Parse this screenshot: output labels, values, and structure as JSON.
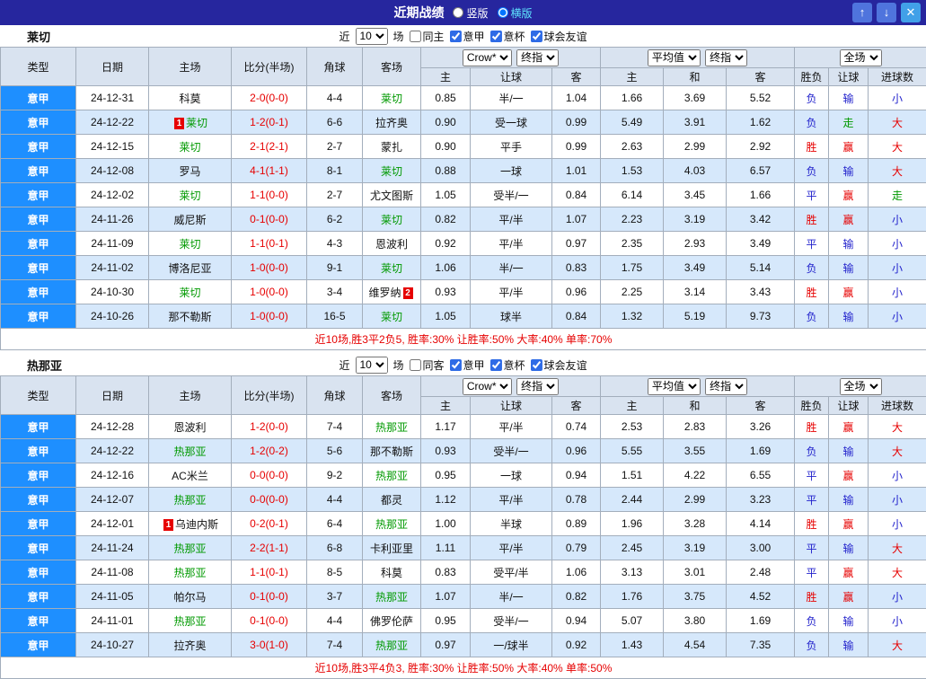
{
  "header": {
    "title": "近期战绩",
    "view_options": [
      {
        "label": "竖版",
        "selected": false
      },
      {
        "label": "横版",
        "selected": true
      }
    ],
    "up_button": "↑",
    "down_button": "↓",
    "close_button": "✕"
  },
  "table_head": {
    "info_columns": [
      "类型",
      "日期",
      "主场",
      "比分(半场)",
      "角球",
      "客场"
    ],
    "sub_columns": [
      "主",
      "让球",
      "客",
      "主",
      "和",
      "客",
      "胜负",
      "让球",
      "进球数"
    ],
    "asia_selects": [
      "Crow*",
      "终指"
    ],
    "euro_selects": [
      "平均值",
      "终指"
    ],
    "scope_select": "全场"
  },
  "colors": {
    "topbar": "#26269e",
    "league_cell": "#1e8fff",
    "subject_team_green": "#009900",
    "score_red": "#e60000",
    "win_red": "#e60000",
    "lose_blue": "#2222cc",
    "push_green": "#009900",
    "alt_row": "#d6e8fb",
    "header_row": "#d9e3f0",
    "active_view": "#5fe6ff"
  },
  "sections": [
    {
      "team": "莱切",
      "controls": {
        "prefix": "近",
        "count": "10",
        "suffix": "场",
        "checkboxes": [
          {
            "label": "同主",
            "checked": false
          },
          {
            "label": "意甲",
            "checked": true
          },
          {
            "label": "意杯",
            "checked": true
          },
          {
            "label": "球会友谊",
            "checked": true
          }
        ]
      },
      "rows": [
        {
          "league": "意甲",
          "date": "24-12-31",
          "home": "科莫",
          "home_cards": "",
          "home_subject": false,
          "score": "2-0(0-0)",
          "corner": "4-4",
          "away": "莱切",
          "away_cards": "",
          "away_subject": true,
          "asia": [
            "0.85",
            "半/一",
            "1.04"
          ],
          "euro": [
            "1.66",
            "3.69",
            "5.52"
          ],
          "results": [
            "负",
            "输",
            "小"
          ]
        },
        {
          "league": "意甲",
          "date": "24-12-22",
          "home": "莱切",
          "home_cards": "1",
          "home_subject": true,
          "score": "1-2(0-1)",
          "corner": "6-6",
          "away": "拉齐奥",
          "away_cards": "",
          "away_subject": false,
          "asia": [
            "0.90",
            "受一球",
            "0.99"
          ],
          "euro": [
            "5.49",
            "3.91",
            "1.62"
          ],
          "results": [
            "负",
            "走",
            "大"
          ]
        },
        {
          "league": "意甲",
          "date": "24-12-15",
          "home": "莱切",
          "home_cards": "",
          "home_subject": true,
          "score": "2-1(2-1)",
          "corner": "2-7",
          "away": "蒙扎",
          "away_cards": "",
          "away_subject": false,
          "asia": [
            "0.90",
            "平手",
            "0.99"
          ],
          "euro": [
            "2.63",
            "2.99",
            "2.92"
          ],
          "results": [
            "胜",
            "赢",
            "大"
          ]
        },
        {
          "league": "意甲",
          "date": "24-12-08",
          "home": "罗马",
          "home_cards": "",
          "home_subject": false,
          "score": "4-1(1-1)",
          "corner": "8-1",
          "away": "莱切",
          "away_cards": "",
          "away_subject": true,
          "asia": [
            "0.88",
            "一球",
            "1.01"
          ],
          "euro": [
            "1.53",
            "4.03",
            "6.57"
          ],
          "results": [
            "负",
            "输",
            "大"
          ]
        },
        {
          "league": "意甲",
          "date": "24-12-02",
          "home": "莱切",
          "home_cards": "",
          "home_subject": true,
          "score": "1-1(0-0)",
          "corner": "2-7",
          "away": "尤文图斯",
          "away_cards": "",
          "away_subject": false,
          "asia": [
            "1.05",
            "受半/一",
            "0.84"
          ],
          "euro": [
            "6.14",
            "3.45",
            "1.66"
          ],
          "results": [
            "平",
            "赢",
            "走"
          ]
        },
        {
          "league": "意甲",
          "date": "24-11-26",
          "home": "威尼斯",
          "home_cards": "",
          "home_subject": false,
          "score": "0-1(0-0)",
          "corner": "6-2",
          "away": "莱切",
          "away_cards": "",
          "away_subject": true,
          "asia": [
            "0.82",
            "平/半",
            "1.07"
          ],
          "euro": [
            "2.23",
            "3.19",
            "3.42"
          ],
          "results": [
            "胜",
            "赢",
            "小"
          ]
        },
        {
          "league": "意甲",
          "date": "24-11-09",
          "home": "莱切",
          "home_cards": "",
          "home_subject": true,
          "score": "1-1(0-1)",
          "corner": "4-3",
          "away": "恩波利",
          "away_cards": "",
          "away_subject": false,
          "asia": [
            "0.92",
            "平/半",
            "0.97"
          ],
          "euro": [
            "2.35",
            "2.93",
            "3.49"
          ],
          "results": [
            "平",
            "输",
            "小"
          ]
        },
        {
          "league": "意甲",
          "date": "24-11-02",
          "home": "博洛尼亚",
          "home_cards": "",
          "home_subject": false,
          "score": "1-0(0-0)",
          "corner": "9-1",
          "away": "莱切",
          "away_cards": "",
          "away_subject": true,
          "asia": [
            "1.06",
            "半/一",
            "0.83"
          ],
          "euro": [
            "1.75",
            "3.49",
            "5.14"
          ],
          "results": [
            "负",
            "输",
            "小"
          ]
        },
        {
          "league": "意甲",
          "date": "24-10-30",
          "home": "莱切",
          "home_cards": "",
          "home_subject": true,
          "score": "1-0(0-0)",
          "corner": "3-4",
          "away": "维罗纳",
          "away_cards": "2",
          "away_subject": false,
          "asia": [
            "0.93",
            "平/半",
            "0.96"
          ],
          "euro": [
            "2.25",
            "3.14",
            "3.43"
          ],
          "results": [
            "胜",
            "赢",
            "小"
          ]
        },
        {
          "league": "意甲",
          "date": "24-10-26",
          "home": "那不勒斯",
          "home_cards": "",
          "home_subject": false,
          "score": "1-0(0-0)",
          "corner": "16-5",
          "away": "莱切",
          "away_cards": "",
          "away_subject": true,
          "asia": [
            "1.05",
            "球半",
            "0.84"
          ],
          "euro": [
            "1.32",
            "5.19",
            "9.73"
          ],
          "results": [
            "负",
            "输",
            "小"
          ]
        }
      ],
      "summary": "近10场,胜3平2负5, 胜率:30% 让胜率:50% 大率:40% 单率:70%"
    },
    {
      "team": "热那亚",
      "controls": {
        "prefix": "近",
        "count": "10",
        "suffix": "场",
        "checkboxes": [
          {
            "label": "同客",
            "checked": false
          },
          {
            "label": "意甲",
            "checked": true
          },
          {
            "label": "意杯",
            "checked": true
          },
          {
            "label": "球会友谊",
            "checked": true
          }
        ]
      },
      "rows": [
        {
          "league": "意甲",
          "date": "24-12-28",
          "home": "恩波利",
          "home_cards": "",
          "home_subject": false,
          "score": "1-2(0-0)",
          "corner": "7-4",
          "away": "热那亚",
          "away_cards": "",
          "away_subject": true,
          "asia": [
            "1.17",
            "平/半",
            "0.74"
          ],
          "euro": [
            "2.53",
            "2.83",
            "3.26"
          ],
          "results": [
            "胜",
            "赢",
            "大"
          ]
        },
        {
          "league": "意甲",
          "date": "24-12-22",
          "home": "热那亚",
          "home_cards": "",
          "home_subject": true,
          "score": "1-2(0-2)",
          "corner": "5-6",
          "away": "那不勒斯",
          "away_cards": "",
          "away_subject": false,
          "asia": [
            "0.93",
            "受半/一",
            "0.96"
          ],
          "euro": [
            "5.55",
            "3.55",
            "1.69"
          ],
          "results": [
            "负",
            "输",
            "大"
          ]
        },
        {
          "league": "意甲",
          "date": "24-12-16",
          "home": "AC米兰",
          "home_cards": "",
          "home_subject": false,
          "score": "0-0(0-0)",
          "corner": "9-2",
          "away": "热那亚",
          "away_cards": "",
          "away_subject": true,
          "asia": [
            "0.95",
            "一球",
            "0.94"
          ],
          "euro": [
            "1.51",
            "4.22",
            "6.55"
          ],
          "results": [
            "平",
            "赢",
            "小"
          ]
        },
        {
          "league": "意甲",
          "date": "24-12-07",
          "home": "热那亚",
          "home_cards": "",
          "home_subject": true,
          "score": "0-0(0-0)",
          "corner": "4-4",
          "away": "都灵",
          "away_cards": "",
          "away_subject": false,
          "asia": [
            "1.12",
            "平/半",
            "0.78"
          ],
          "euro": [
            "2.44",
            "2.99",
            "3.23"
          ],
          "results": [
            "平",
            "输",
            "小"
          ]
        },
        {
          "league": "意甲",
          "date": "24-12-01",
          "home": "乌迪内斯",
          "home_cards": "1",
          "home_subject": false,
          "score": "0-2(0-1)",
          "corner": "6-4",
          "away": "热那亚",
          "away_cards": "",
          "away_subject": true,
          "asia": [
            "1.00",
            "半球",
            "0.89"
          ],
          "euro": [
            "1.96",
            "3.28",
            "4.14"
          ],
          "results": [
            "胜",
            "赢",
            "小"
          ]
        },
        {
          "league": "意甲",
          "date": "24-11-24",
          "home": "热那亚",
          "home_cards": "",
          "home_subject": true,
          "score": "2-2(1-1)",
          "corner": "6-8",
          "away": "卡利亚里",
          "away_cards": "",
          "away_subject": false,
          "asia": [
            "1.11",
            "平/半",
            "0.79"
          ],
          "euro": [
            "2.45",
            "3.19",
            "3.00"
          ],
          "results": [
            "平",
            "输",
            "大"
          ]
        },
        {
          "league": "意甲",
          "date": "24-11-08",
          "home": "热那亚",
          "home_cards": "",
          "home_subject": true,
          "score": "1-1(0-1)",
          "corner": "8-5",
          "away": "科莫",
          "away_cards": "",
          "away_subject": false,
          "asia": [
            "0.83",
            "受平/半",
            "1.06"
          ],
          "euro": [
            "3.13",
            "3.01",
            "2.48"
          ],
          "results": [
            "平",
            "赢",
            "大"
          ]
        },
        {
          "league": "意甲",
          "date": "24-11-05",
          "home": "帕尔马",
          "home_cards": "",
          "home_subject": false,
          "score": "0-1(0-0)",
          "corner": "3-7",
          "away": "热那亚",
          "away_cards": "",
          "away_subject": true,
          "asia": [
            "1.07",
            "半/一",
            "0.82"
          ],
          "euro": [
            "1.76",
            "3.75",
            "4.52"
          ],
          "results": [
            "胜",
            "赢",
            "小"
          ]
        },
        {
          "league": "意甲",
          "date": "24-11-01",
          "home": "热那亚",
          "home_cards": "",
          "home_subject": true,
          "score": "0-1(0-0)",
          "corner": "4-4",
          "away": "佛罗伦萨",
          "away_cards": "",
          "away_subject": false,
          "asia": [
            "0.95",
            "受半/一",
            "0.94"
          ],
          "euro": [
            "5.07",
            "3.80",
            "1.69"
          ],
          "results": [
            "负",
            "输",
            "小"
          ]
        },
        {
          "league": "意甲",
          "date": "24-10-27",
          "home": "拉齐奥",
          "home_cards": "",
          "home_subject": false,
          "score": "3-0(1-0)",
          "corner": "7-4",
          "away": "热那亚",
          "away_cards": "",
          "away_subject": true,
          "asia": [
            "0.97",
            "一/球半",
            "0.92"
          ],
          "euro": [
            "1.43",
            "4.54",
            "7.35"
          ],
          "results": [
            "负",
            "输",
            "大"
          ]
        }
      ],
      "summary": "近10场,胜3平4负3, 胜率:30% 让胜率:50% 大率:40% 单率:50%"
    }
  ]
}
